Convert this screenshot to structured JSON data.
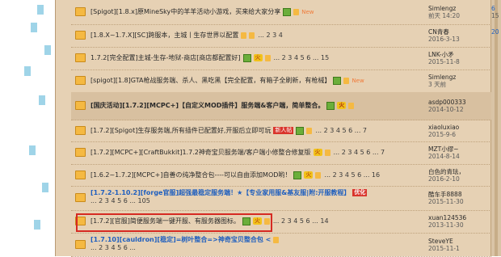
{
  "threads": [
    {
      "title": "[Spigot][1.8.x]原MineSky中的羊羊活动小游戏，买来给大家分享",
      "pages": "",
      "new": "New",
      "author": "Simlengz",
      "date": "前天 14:20",
      "replies": "6",
      "views": "15",
      "blue": false,
      "bold": false,
      "badges": [
        "img",
        "thumb"
      ]
    },
    {
      "title": "[1.8.X~1.7.X][SC]跨服本，主城丨生存世界以配置",
      "pages": "... 2 3 4",
      "new": "",
      "author": "CN青春",
      "date": "2016-3-13",
      "replies": "20",
      "views": "",
      "blue": false,
      "bold": false,
      "badges": [
        "thumb",
        "thumb"
      ]
    },
    {
      "title": "1.7.2[完全配置]主城-生存-地狱-商店[商店都配置好]",
      "pages": "... 2 3 4 5 6 ... 15",
      "new": "",
      "author": "LNK-小矛",
      "date": "2015-11-8",
      "replies": "",
      "views": "",
      "blue": false,
      "bold": false,
      "badges": [
        "img",
        "hot",
        "thumb"
      ]
    },
    {
      "title": "[spigot][1.8]GTA枪战服务端、杀人、黑吃黑【完全配置，有箱子全刷新，有枪械】",
      "pages": "",
      "new": "New",
      "author": "Simlengz",
      "date": "3 天前",
      "replies": "",
      "views": "",
      "blue": false,
      "bold": false,
      "badges": [
        "img",
        "thumb"
      ]
    },
    {
      "title": "[国庆活动][1.7.2][MCPC+]【自定义MOD插件】服务端&客户端，简单整合。",
      "pages": "",
      "new": "",
      "author": "asdp000333",
      "date": "2014-10-12",
      "replies": "",
      "views": "",
      "blue": false,
      "bold": true,
      "badges": [
        "img",
        "hot",
        "thumb"
      ]
    },
    {
      "title": "[1.7.2][Spigot]生存服务端,所有插件已配置好,开服后立即可玩",
      "pages": "... 2 3 4 5 6 ... 7",
      "new": "",
      "author": "xiaoluxiao",
      "date": "2015-9-6",
      "replies": "",
      "views": "",
      "blue": false,
      "bold": false,
      "badges": [
        "red",
        "img",
        "thumb"
      ],
      "red_label": "新人帖"
    },
    {
      "title": "[1.7.2][MCPC+][CraftBukkit]1.7.2神奇宝贝服务端/客户端小修整合修复版",
      "pages": "... 2 3 4 5 6 ... 7",
      "new": "",
      "author": "MZT小缪~",
      "date": "2014-8-14",
      "replies": "",
      "views": "",
      "blue": false,
      "bold": false,
      "badges": [
        "hot",
        "thumb"
      ]
    },
    {
      "title": "[1.6.2~1.7.2][MCPC+]自善の纯净整合包----可以自由添加MOD哟！",
      "pages": "... 2 3 4 5 6 ... 16",
      "new": "",
      "author": "白色的青珐，",
      "date": "2016-2-10",
      "replies": "",
      "views": "",
      "blue": false,
      "bold": false,
      "badges": [
        "img",
        "hot",
        "thumb"
      ]
    },
    {
      "title": "[1.7.2-1.10.2][forge官服]超强最稳定服务端！★【专业家用服&基友服|附:开服教程】",
      "pages": "... 2 3 4 5 6 ... 105",
      "new": "",
      "author": "酷车手8888",
      "date": "2015-11-30",
      "replies": "",
      "views": "",
      "blue": true,
      "bold": true,
      "badges": [
        "red"
      ],
      "red_label": "优化"
    },
    {
      "title": "[1.7.2][官服]简便服务端一键开服、有服务器图标。",
      "pages": "... 2 3 4 5 6 ... 14",
      "new": "",
      "author": "xuan124536",
      "date": "2013-11-30",
      "replies": "",
      "views": "",
      "blue": false,
      "bold": false,
      "badges": [
        "img",
        "hot",
        "thumb"
      ]
    },
    {
      "title": "[1.7.10][cauldron][稳定]=树叶整合=>神奇宝贝整合包 <",
      "pages": "... 2 3 4 5 6 ...",
      "new": "",
      "author": "SteveYE",
      "date": "2015-11-1",
      "replies": "",
      "views": "",
      "blue": true,
      "bold": true,
      "badges": [
        "thumb"
      ]
    }
  ]
}
